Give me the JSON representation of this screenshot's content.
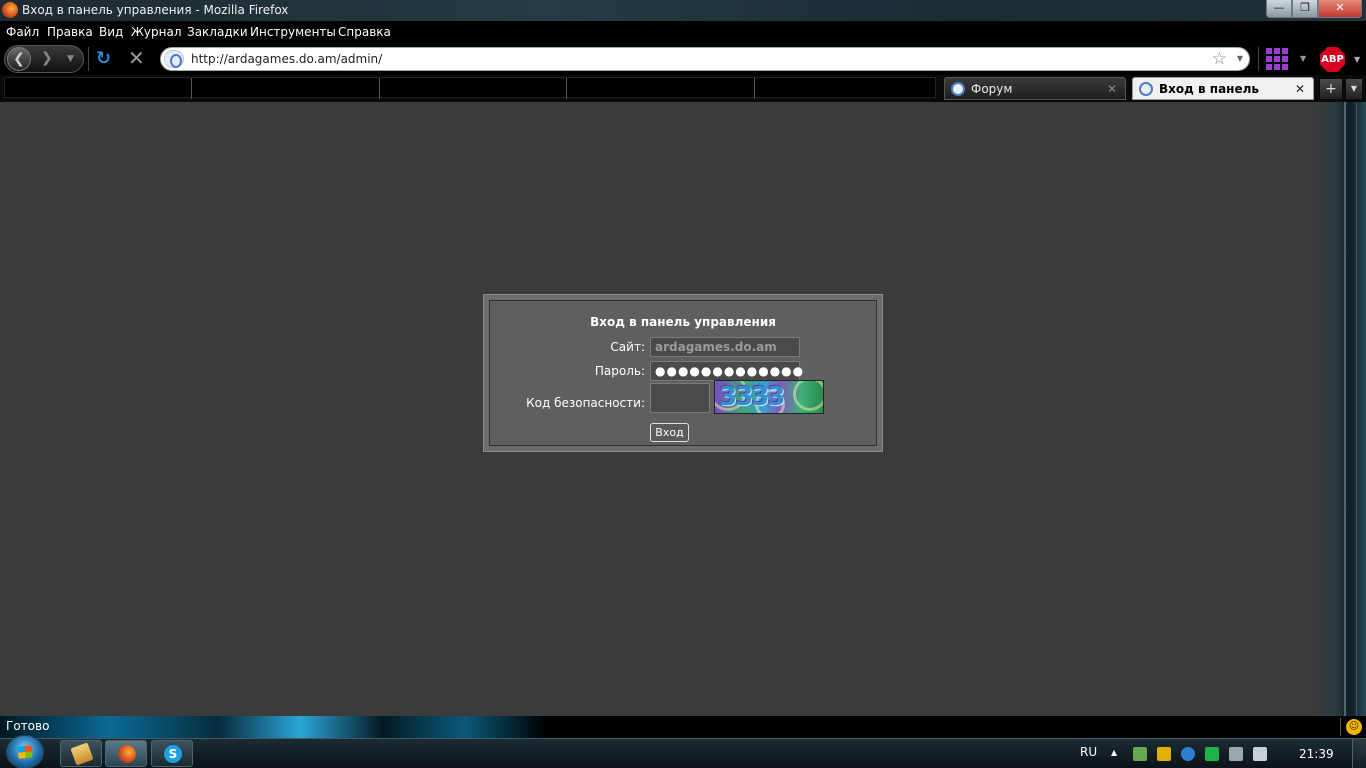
{
  "window": {
    "title": "Вход в панель управления - Mozilla Firefox",
    "buttons": {
      "minimize": "—",
      "maximize": "❐",
      "close": "✕"
    }
  },
  "menubar": {
    "items": [
      "Файл",
      "Правка",
      "Вид",
      "Журнал",
      "Закладки",
      "Инструменты",
      "Справка"
    ]
  },
  "navbar": {
    "url": "http://ardagames.do.am/admin/",
    "abp_label": "ABP"
  },
  "tabs": [
    {
      "label": "Форум",
      "active": false
    },
    {
      "label": "Вход в панель управ...",
      "active": true
    }
  ],
  "login": {
    "title": "Вход в панель управления",
    "site_label": "Сайт:",
    "site_value": "ardagames.do.am",
    "password_label": "Пароль:",
    "password_value": "●●●●●●●●●●●●●",
    "captcha_label": "Код безопасности:",
    "captcha_text": "3333",
    "submit_label": "Вход"
  },
  "statusbar": {
    "text": "Готово"
  },
  "taskbar": {
    "language": "RU",
    "clock": "21:39",
    "apps": [
      "folder-icon",
      "firefox-icon",
      "skype-icon"
    ]
  },
  "colors": {
    "content_bg": "#3b3b3b",
    "panel_outer": "#6c6c6c",
    "panel_inner": "#5f5f5f",
    "abp_red": "#d8001f",
    "tray_purple": "#9b3dd0"
  }
}
